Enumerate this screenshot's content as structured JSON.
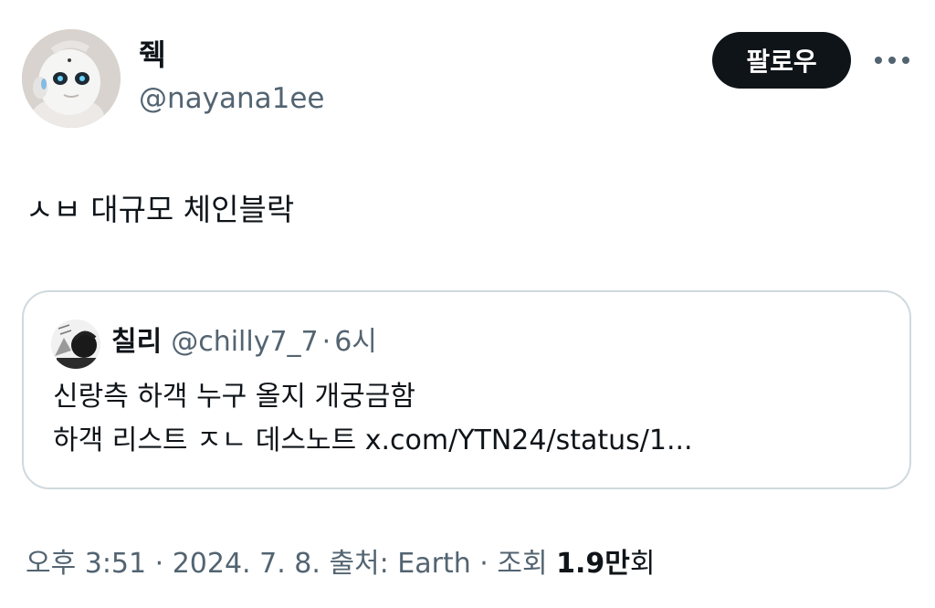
{
  "author": {
    "display_name": "줵",
    "handle": "@nayana1ee"
  },
  "actions": {
    "follow_label": "팔로우",
    "more_icon": "more-horizontal-icon"
  },
  "tweet": {
    "text": "ㅅㅂ 대규모 체인블락"
  },
  "quoted_tweet": {
    "display_name": "칠리",
    "handle": "@chilly7_7",
    "separator": "·",
    "time": "6시",
    "line1": "신랑측 하객 누구 올지 개궁금함",
    "line2": "하객 리스트 ㅈㄴ 데스노트 x.com/YTN24/status/1..."
  },
  "meta": {
    "prefix": "오후 3:51 · 2024. 7. 8. 출처: Earth · 조회 ",
    "views_count": "1.9",
    "views_unit_bold": "만",
    "views_suffix": "회"
  },
  "colors": {
    "text_primary": "#0f1419",
    "text_secondary": "#536471",
    "border": "#cfd9de",
    "follow_bg": "#0f1419"
  }
}
